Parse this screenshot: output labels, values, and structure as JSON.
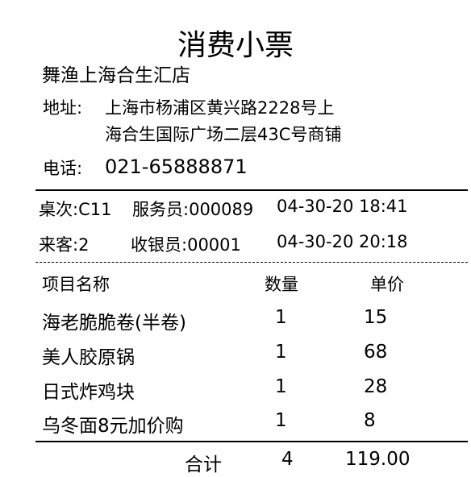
{
  "receipt": {
    "title": "消费小票",
    "store_name": "舞渔上海合生汇店",
    "address_label": "地址:",
    "address_line1": "上海市杨浦区黄兴路2228号上",
    "address_line2": "海合生国际广场二层43C号商铺",
    "phone_label": "电话:",
    "phone": "021-65888871",
    "table_label": "桌次:",
    "table": "C11",
    "waiter_label": "服务员:",
    "waiter": "000089",
    "open_time": "04-30-20 18:41",
    "guests_label": "来客:",
    "guests": "2",
    "cashier_label": "收银员:",
    "cashier": "00001",
    "close_time": "04-30-20 20:18",
    "columns": {
      "name": "项目名称",
      "qty": "数量",
      "price": "单价"
    },
    "items": [
      {
        "name": "海老脆脆卷(半卷)",
        "qty": "1",
        "price": "15"
      },
      {
        "name": "美人胶原锅",
        "qty": "1",
        "price": "68"
      },
      {
        "name": "日式炸鸡块",
        "qty": "1",
        "price": "28"
      },
      {
        "name": "乌冬面8元加价购",
        "qty": "1",
        "price": "8"
      }
    ],
    "total_label": "合计",
    "total_qty": "4",
    "total_amount": "119.00"
  }
}
